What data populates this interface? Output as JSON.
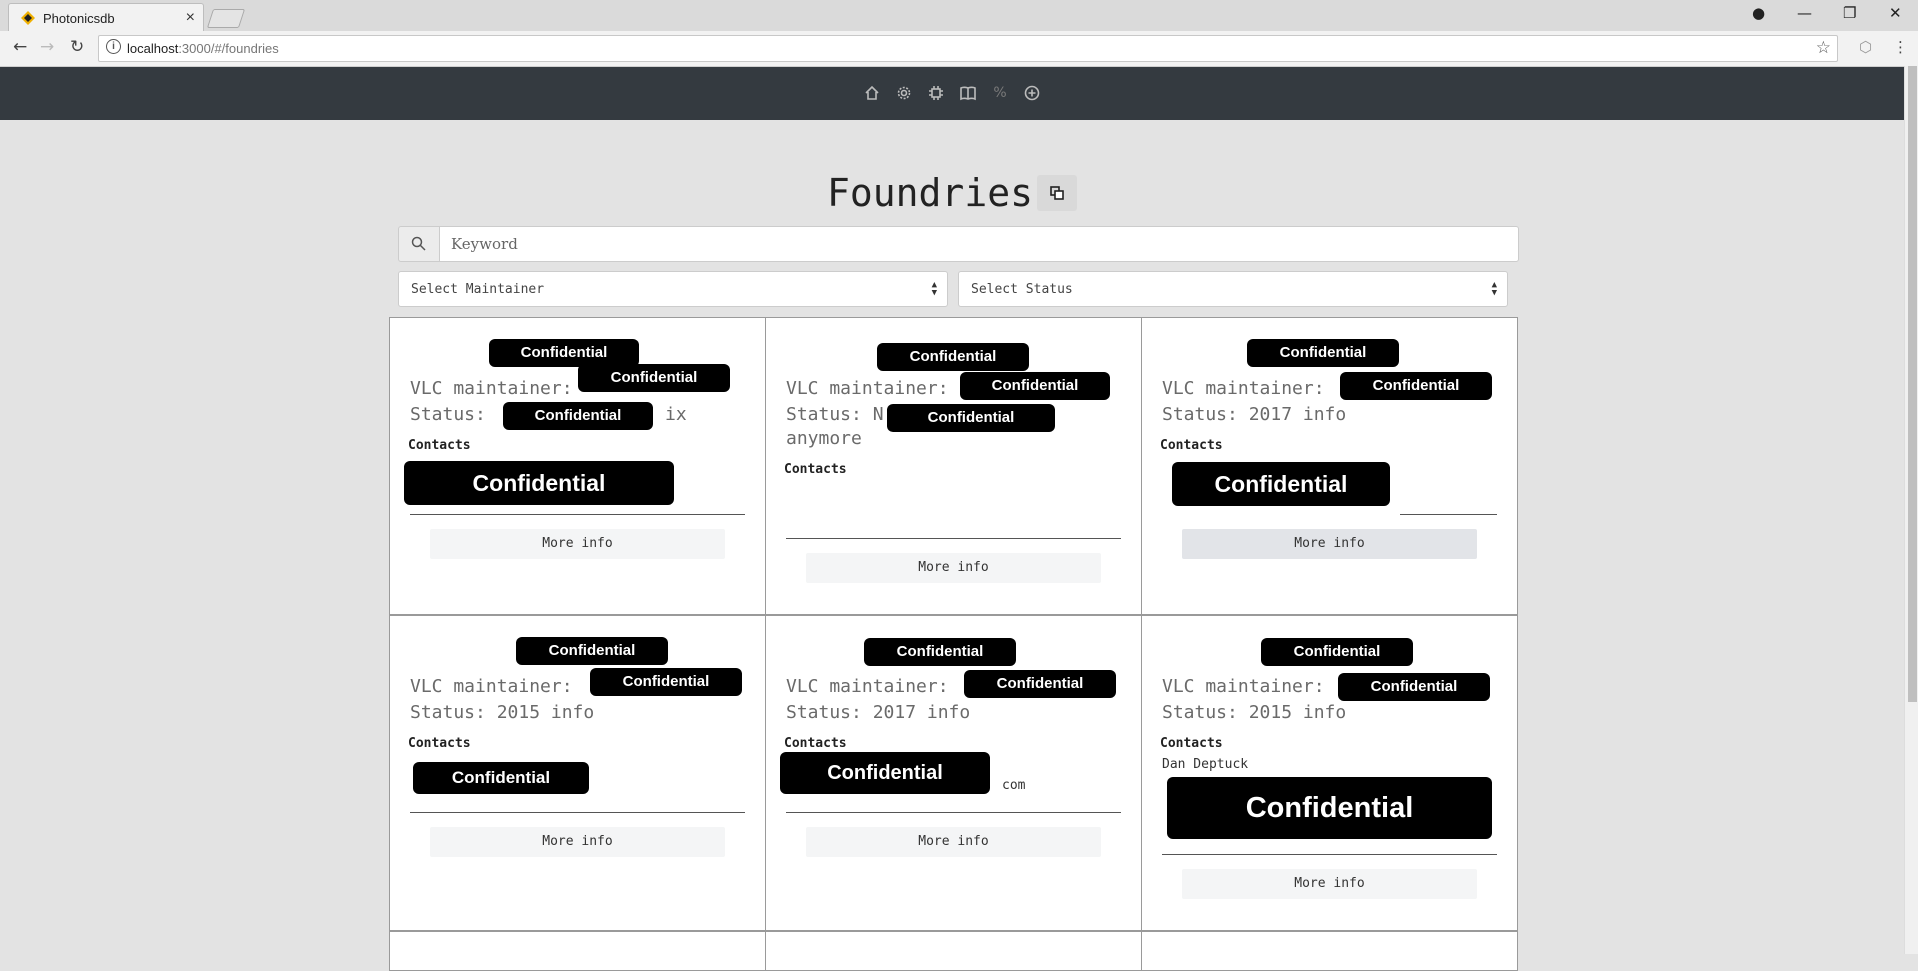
{
  "browser": {
    "tab_title": "Photonicsdb",
    "tab_close": "×",
    "url_host": "localhost",
    "url_rest": ":3000/#/foundries"
  },
  "page": {
    "title": "Foundries",
    "search_placeholder": "Keyword",
    "maintainer_select": "Select Maintainer",
    "status_select": "Select Status"
  },
  "redaction_label": "Confidential",
  "cards": [
    {
      "maintainer": "VLC maintainer:",
      "status": "Status:",
      "status_suffix": "ix",
      "contacts": "Contacts",
      "more": "More info"
    },
    {
      "maintainer": "VLC maintainer:",
      "status": "Status: N",
      "status_line2": "anymore",
      "contacts": "Contacts",
      "more": "More info"
    },
    {
      "maintainer": "VLC maintainer:",
      "status": "Status: 2017 info",
      "contacts": "Contacts",
      "more": "More info"
    },
    {
      "maintainer": "VLC maintainer:",
      "status": "Status: 2015 info",
      "contacts": "Contacts",
      "more": "More info"
    },
    {
      "maintainer": "VLC maintainer:",
      "status": "Status: 2017 info",
      "contacts": "Contacts",
      "contact_suffix": "com",
      "more": "More info"
    },
    {
      "maintainer": "VLC maintainer:",
      "status": "Status: 2015 info",
      "contacts": "Contacts",
      "contact_name": "Dan Deptuck",
      "more": "More info"
    }
  ]
}
